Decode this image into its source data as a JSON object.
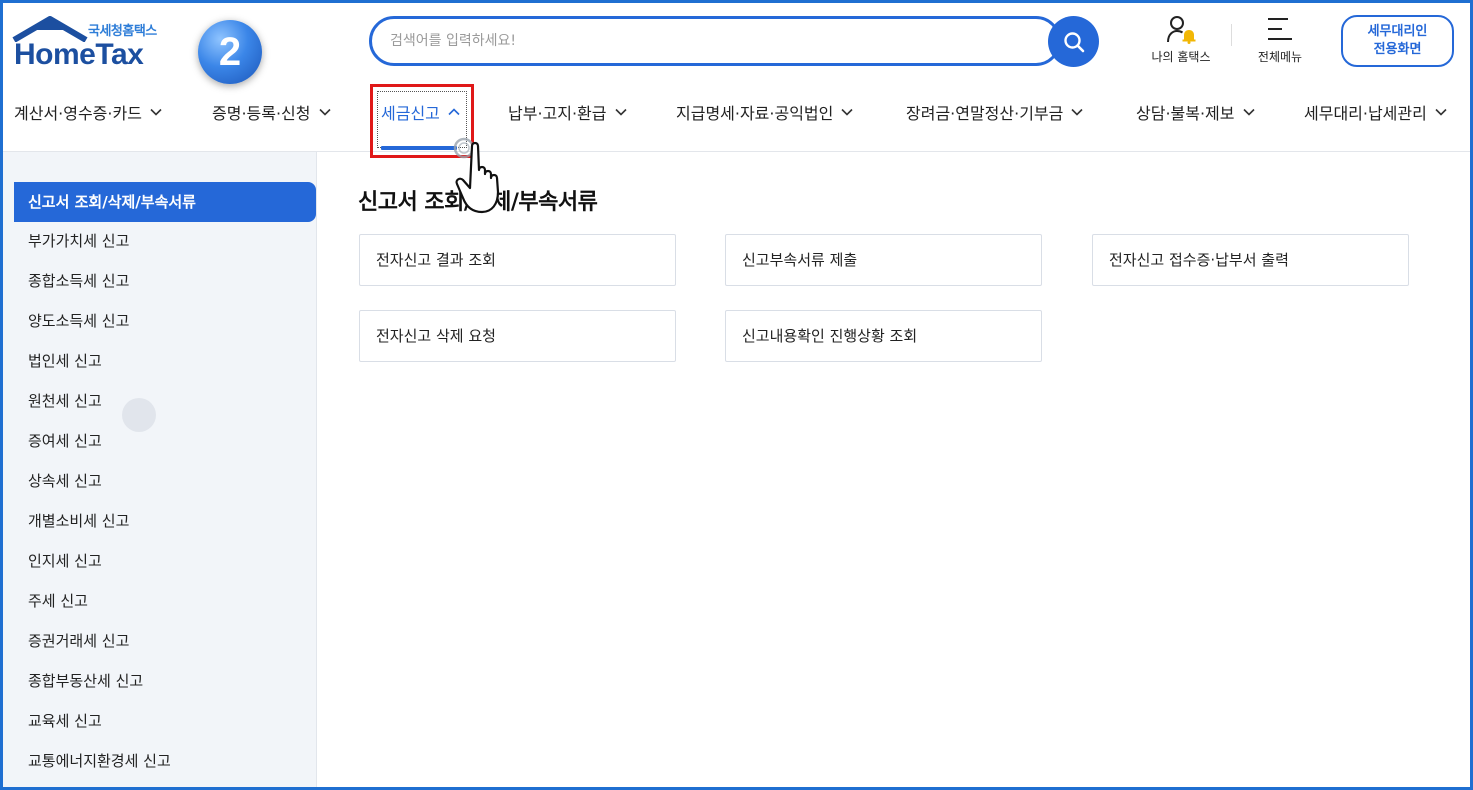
{
  "logo": {
    "subtitle": "국세청홈택스",
    "title": "HomeTax"
  },
  "step_badge": "2",
  "search": {
    "placeholder": "검색어를 입력하세요!",
    "value": ""
  },
  "utilities": {
    "my_hometax": "나의 홈택스",
    "all_menu": "전체메뉴"
  },
  "agent_button": {
    "line1": "세무대리인",
    "line2": "전용화면"
  },
  "gnb": [
    {
      "label": "계산서·영수증·카드",
      "active": false
    },
    {
      "label": "증명·등록·신청",
      "active": false
    },
    {
      "label": "세금신고",
      "active": true
    },
    {
      "label": "납부·고지·환급",
      "active": false
    },
    {
      "label": "지급명세·자료·공익법인",
      "active": false
    },
    {
      "label": "장려금·연말정산·기부금",
      "active": false
    },
    {
      "label": "상담·불복·제보",
      "active": false
    },
    {
      "label": "세무대리·납세관리",
      "active": false
    }
  ],
  "sidebar": {
    "active": "신고서 조회/삭제/부속서류",
    "items": [
      "부가가치세 신고",
      "종합소득세 신고",
      "양도소득세 신고",
      "법인세 신고",
      "원천세 신고",
      "증여세 신고",
      "상속세 신고",
      "개별소비세 신고",
      "인지세 신고",
      "주세 신고",
      "증권거래세 신고",
      "종합부동산세 신고",
      "교육세 신고",
      "교통에너지환경세 신고"
    ]
  },
  "main": {
    "title": "신고서 조회/삭제/부속서류",
    "cards": [
      "전자신고 결과 조회",
      "신고부속서류 제출",
      "전자신고 접수증·납부서 출력",
      "전자신고 삭제 요청",
      "신고내용확인 진행상황 조회"
    ]
  },
  "colors": {
    "accent": "#2568d8",
    "highlight_box": "#e01818",
    "sidebar_bg": "#f2f5f9"
  },
  "icons": [
    "house-roof-icon",
    "search-icon",
    "user-bell-icon",
    "hamburger-menu-icon",
    "chevron-down-icon",
    "chevron-up-icon",
    "pointer-hand-icon"
  ]
}
